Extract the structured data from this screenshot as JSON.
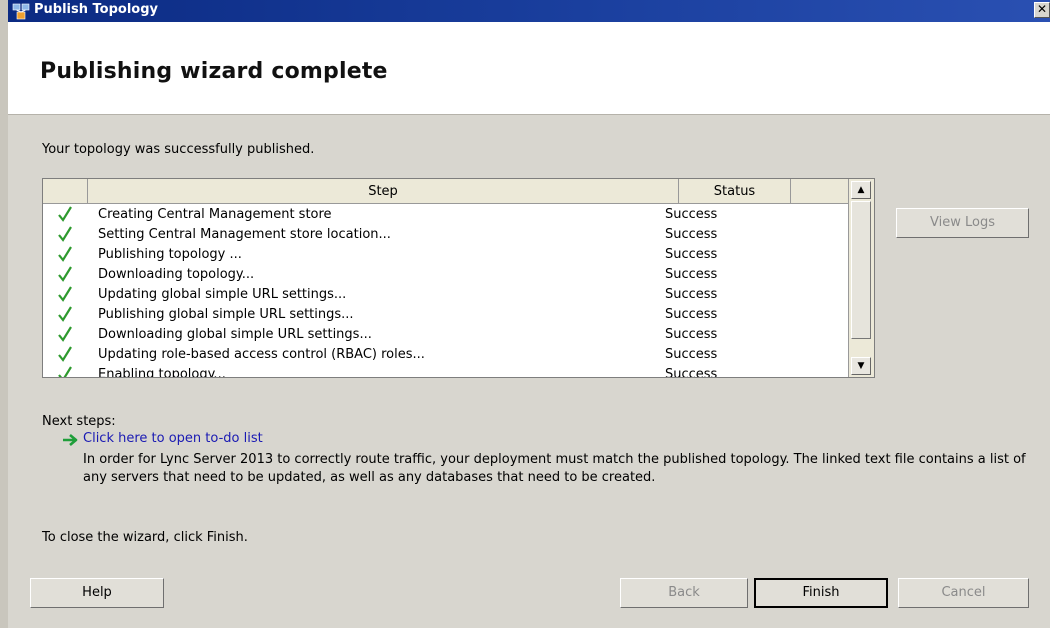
{
  "window": {
    "title": "Publish Topology",
    "close_symbol": "✕"
  },
  "header": {
    "heading": "Publishing wizard complete"
  },
  "message": "Your topology was successfully published.",
  "grid": {
    "columns": [
      "Step",
      "Status"
    ],
    "rows": [
      {
        "step": "Creating Central Management store",
        "status": "Success"
      },
      {
        "step": "Setting Central Management store location...",
        "status": "Success"
      },
      {
        "step": "Publishing topology ...",
        "status": "Success"
      },
      {
        "step": "Downloading topology...",
        "status": "Success"
      },
      {
        "step": "Updating global simple URL settings...",
        "status": "Success"
      },
      {
        "step": "Publishing global simple URL settings...",
        "status": "Success"
      },
      {
        "step": "Downloading global simple URL settings...",
        "status": "Success"
      },
      {
        "step": "Updating role-based access control (RBAC) roles...",
        "status": "Success"
      },
      {
        "step": "Enabling topology...",
        "status": "Success"
      }
    ]
  },
  "view_logs_label": "View Logs",
  "next_steps": {
    "label": "Next steps:",
    "link": "Click here to open to-do list",
    "description": "In order for Lync Server 2013 to correctly route traffic, your deployment must match the published topology. The linked text file contains a list of any servers that need to be updated, as well as any databases that need to be created."
  },
  "close_message": "To close the wizard, click Finish.",
  "buttons": {
    "help": "Help",
    "back": "Back",
    "finish": "Finish",
    "cancel": "Cancel"
  },
  "colors": {
    "titlebar": "#0b2a82",
    "check": "#2e9a2e",
    "arrow": "#1f9e3a",
    "link": "#1a1ab3"
  },
  "icons": {
    "app": "topology-app-icon",
    "check": "check-icon",
    "next": "green-arrow-icon"
  }
}
